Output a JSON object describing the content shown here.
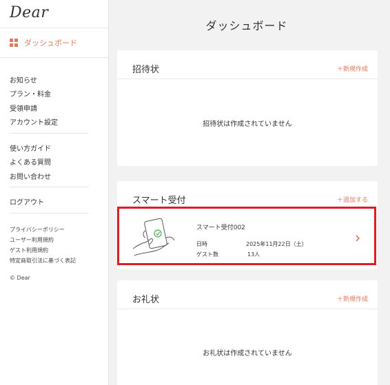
{
  "sidebar": {
    "logo": "Dear",
    "dashboard_label": "ダッシュボード",
    "group1": [
      "お知らせ",
      "プラン・料金",
      "受領申請",
      "アカウント設定"
    ],
    "group2": [
      "使い方ガイド",
      "よくある質問",
      "お問い合わせ"
    ],
    "logout": "ログアウト",
    "policies": [
      "プライバシーポリシー",
      "ユーザー利用規約",
      "ゲスト利用規約",
      "特定商取引法に基づく表記"
    ],
    "copyright": "© Dear"
  },
  "main": {
    "title": "ダッシュボード",
    "invitations": {
      "title": "招待状",
      "action": "＋新規作成",
      "empty": "招待状は作成されていません"
    },
    "smart_reception": {
      "title": "スマート受付",
      "action": "＋追加する",
      "item": {
        "name": "スマート受付002",
        "date_label": "日時",
        "date_value": "2025年11月22日（土）",
        "guests_label": "ゲスト数",
        "guests_value": "13人"
      }
    },
    "thanks": {
      "title": "お礼状",
      "action": "＋新規作成",
      "empty": "お礼状は作成されていません"
    }
  },
  "colors": {
    "accent": "#e07a5f",
    "highlight": "#e01b24",
    "background": "#f2f2f2"
  }
}
